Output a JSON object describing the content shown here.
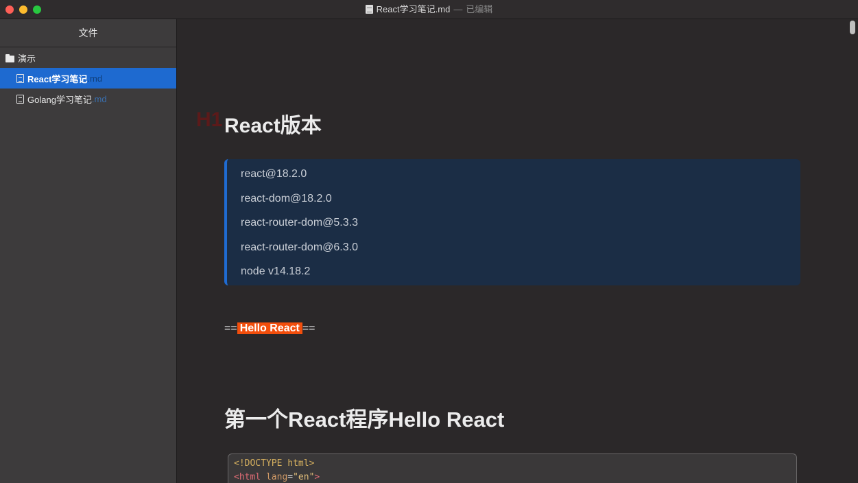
{
  "window": {
    "filename": "React学习笔记.md",
    "separator": "—",
    "status": "已编辑"
  },
  "sidebar": {
    "header": "文件",
    "folder": "演示",
    "files": [
      {
        "name": "React学习笔记",
        "ext": ".md",
        "active": true
      },
      {
        "name": "Golang学习笔记",
        "ext": ".md",
        "active": false
      }
    ]
  },
  "editor": {
    "h1_marker": "H1",
    "h1": "React版本",
    "quote_lines": [
      "react@18.2.0",
      "react-dom@18.2.0",
      "react-router-dom@5.3.3",
      "react-router-dom@6.3.0",
      "node v14.18.2"
    ],
    "highlight": {
      "open": "==",
      "text": "Hello React",
      "close": "=="
    },
    "h2": "第一个React程序Hello React",
    "code": {
      "line1": "<!DOCTYPE html>",
      "line2_open": "<html",
      "line2_attr": "lang",
      "line2_eq": "=",
      "line2_val": "\"en\"",
      "line2_close": ">"
    }
  },
  "colors": {
    "accent": "#1e6ad0",
    "highlight": "#f24e0c",
    "quote_bg": "#1b2d45",
    "h1_marker": "#5c1a1a"
  }
}
